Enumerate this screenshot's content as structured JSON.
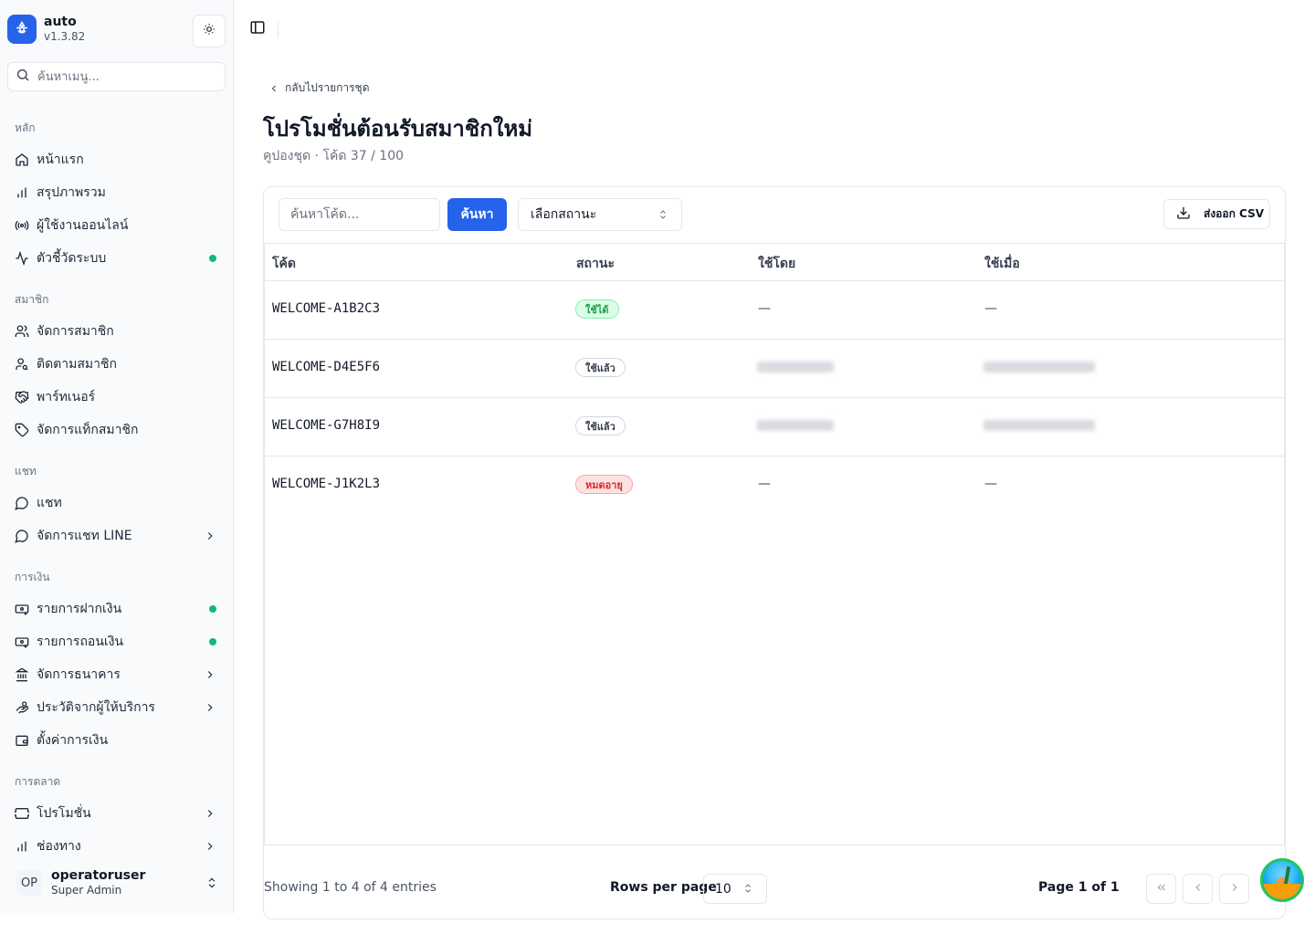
{
  "app": {
    "name": "auto",
    "version": "v1.3.82"
  },
  "sidebar": {
    "search_placeholder": "ค้นหาเมนู...",
    "groups": [
      {
        "label": "หลัก",
        "items": [
          {
            "label": "หน้าแรก",
            "icon": "home-icon"
          },
          {
            "label": "สรุปภาพรวม",
            "icon": "bar-chart-icon"
          },
          {
            "label": "ผู้ใช้งานออนไลน์",
            "icon": "radio-icon"
          },
          {
            "label": "ตัวชี้วัดระบบ",
            "icon": "activity-icon",
            "status_dot": true
          }
        ]
      },
      {
        "label": "สมาชิก",
        "items": [
          {
            "label": "จัดการสมาชิก",
            "icon": "users-icon"
          },
          {
            "label": "ติดตามสมาชิก",
            "icon": "user-search-icon"
          },
          {
            "label": "พาร์ทเนอร์",
            "icon": "handshake-icon"
          },
          {
            "label": "จัดการแท็กสมาชิก",
            "icon": "tag-icon"
          }
        ]
      },
      {
        "label": "แชท",
        "items": [
          {
            "label": "แชท",
            "icon": "message-circle-icon"
          },
          {
            "label": "จัดการแชท LINE",
            "icon": "message-circle-icon",
            "has_submenu": true
          }
        ]
      },
      {
        "label": "การเงิน",
        "items": [
          {
            "label": "รายการฝากเงิน",
            "icon": "deposit-icon",
            "status_dot": true
          },
          {
            "label": "รายการถอนเงิน",
            "icon": "withdraw-icon",
            "status_dot": true
          },
          {
            "label": "จัดการธนาคาร",
            "icon": "bank-icon",
            "has_submenu": true
          },
          {
            "label": "ประวัติจากผู้ให้บริการ",
            "icon": "history-icon",
            "has_submenu": true
          },
          {
            "label": "ตั้งค่าการเงิน",
            "icon": "wallet-icon"
          }
        ]
      },
      {
        "label": "การตลาด",
        "items": [
          {
            "label": "โปรโมชั่น",
            "icon": "ticket-icon",
            "has_submenu": true
          },
          {
            "label": "ช่องทาง",
            "icon": "bar-chart-icon",
            "has_submenu": true
          }
        ]
      }
    ],
    "user": {
      "initials": "OP",
      "name": "operatoruser",
      "role": "Super Admin"
    }
  },
  "header": {
    "back_label": "กลับไปรายการชุด",
    "title": "โปรโมชั่นต้อนรับสมาชิกใหม่",
    "subtitle": "คูปองชุด · โค้ด 37 / 100"
  },
  "toolbar": {
    "search_placeholder": "ค้นหาโค้ด...",
    "search_button": "ค้นหา",
    "status_select": "เลือกสถานะ",
    "export_label": "ส่งออก CSV"
  },
  "table": {
    "columns": [
      "โค้ด",
      "สถานะ",
      "ใช้โดย",
      "ใช้เมื่อ"
    ],
    "rows": [
      {
        "code": "WELCOME-A1B2C3",
        "status": "ใช้ได้",
        "status_kind": "available",
        "used_by": "—",
        "used_at": "—"
      },
      {
        "code": "WELCOME-D4E5F6",
        "status": "ใช้แล้ว",
        "status_kind": "used",
        "used_by": "",
        "used_at": ""
      },
      {
        "code": "WELCOME-G7H8I9",
        "status": "ใช้แล้ว",
        "status_kind": "used",
        "used_by": "",
        "used_at": ""
      },
      {
        "code": "WELCOME-J1K2L3",
        "status": "หมดอายุ",
        "status_kind": "expired",
        "used_by": "—",
        "used_at": "—"
      }
    ]
  },
  "footer": {
    "showing": "Showing 1 to 4 of 4 entries",
    "rows_per_page_label": "Rows per page",
    "rows_per_page": "10",
    "page_info": "Page 1 of 1"
  },
  "colors": {
    "accent": "#2563eb",
    "status_dot": "#10b981"
  }
}
